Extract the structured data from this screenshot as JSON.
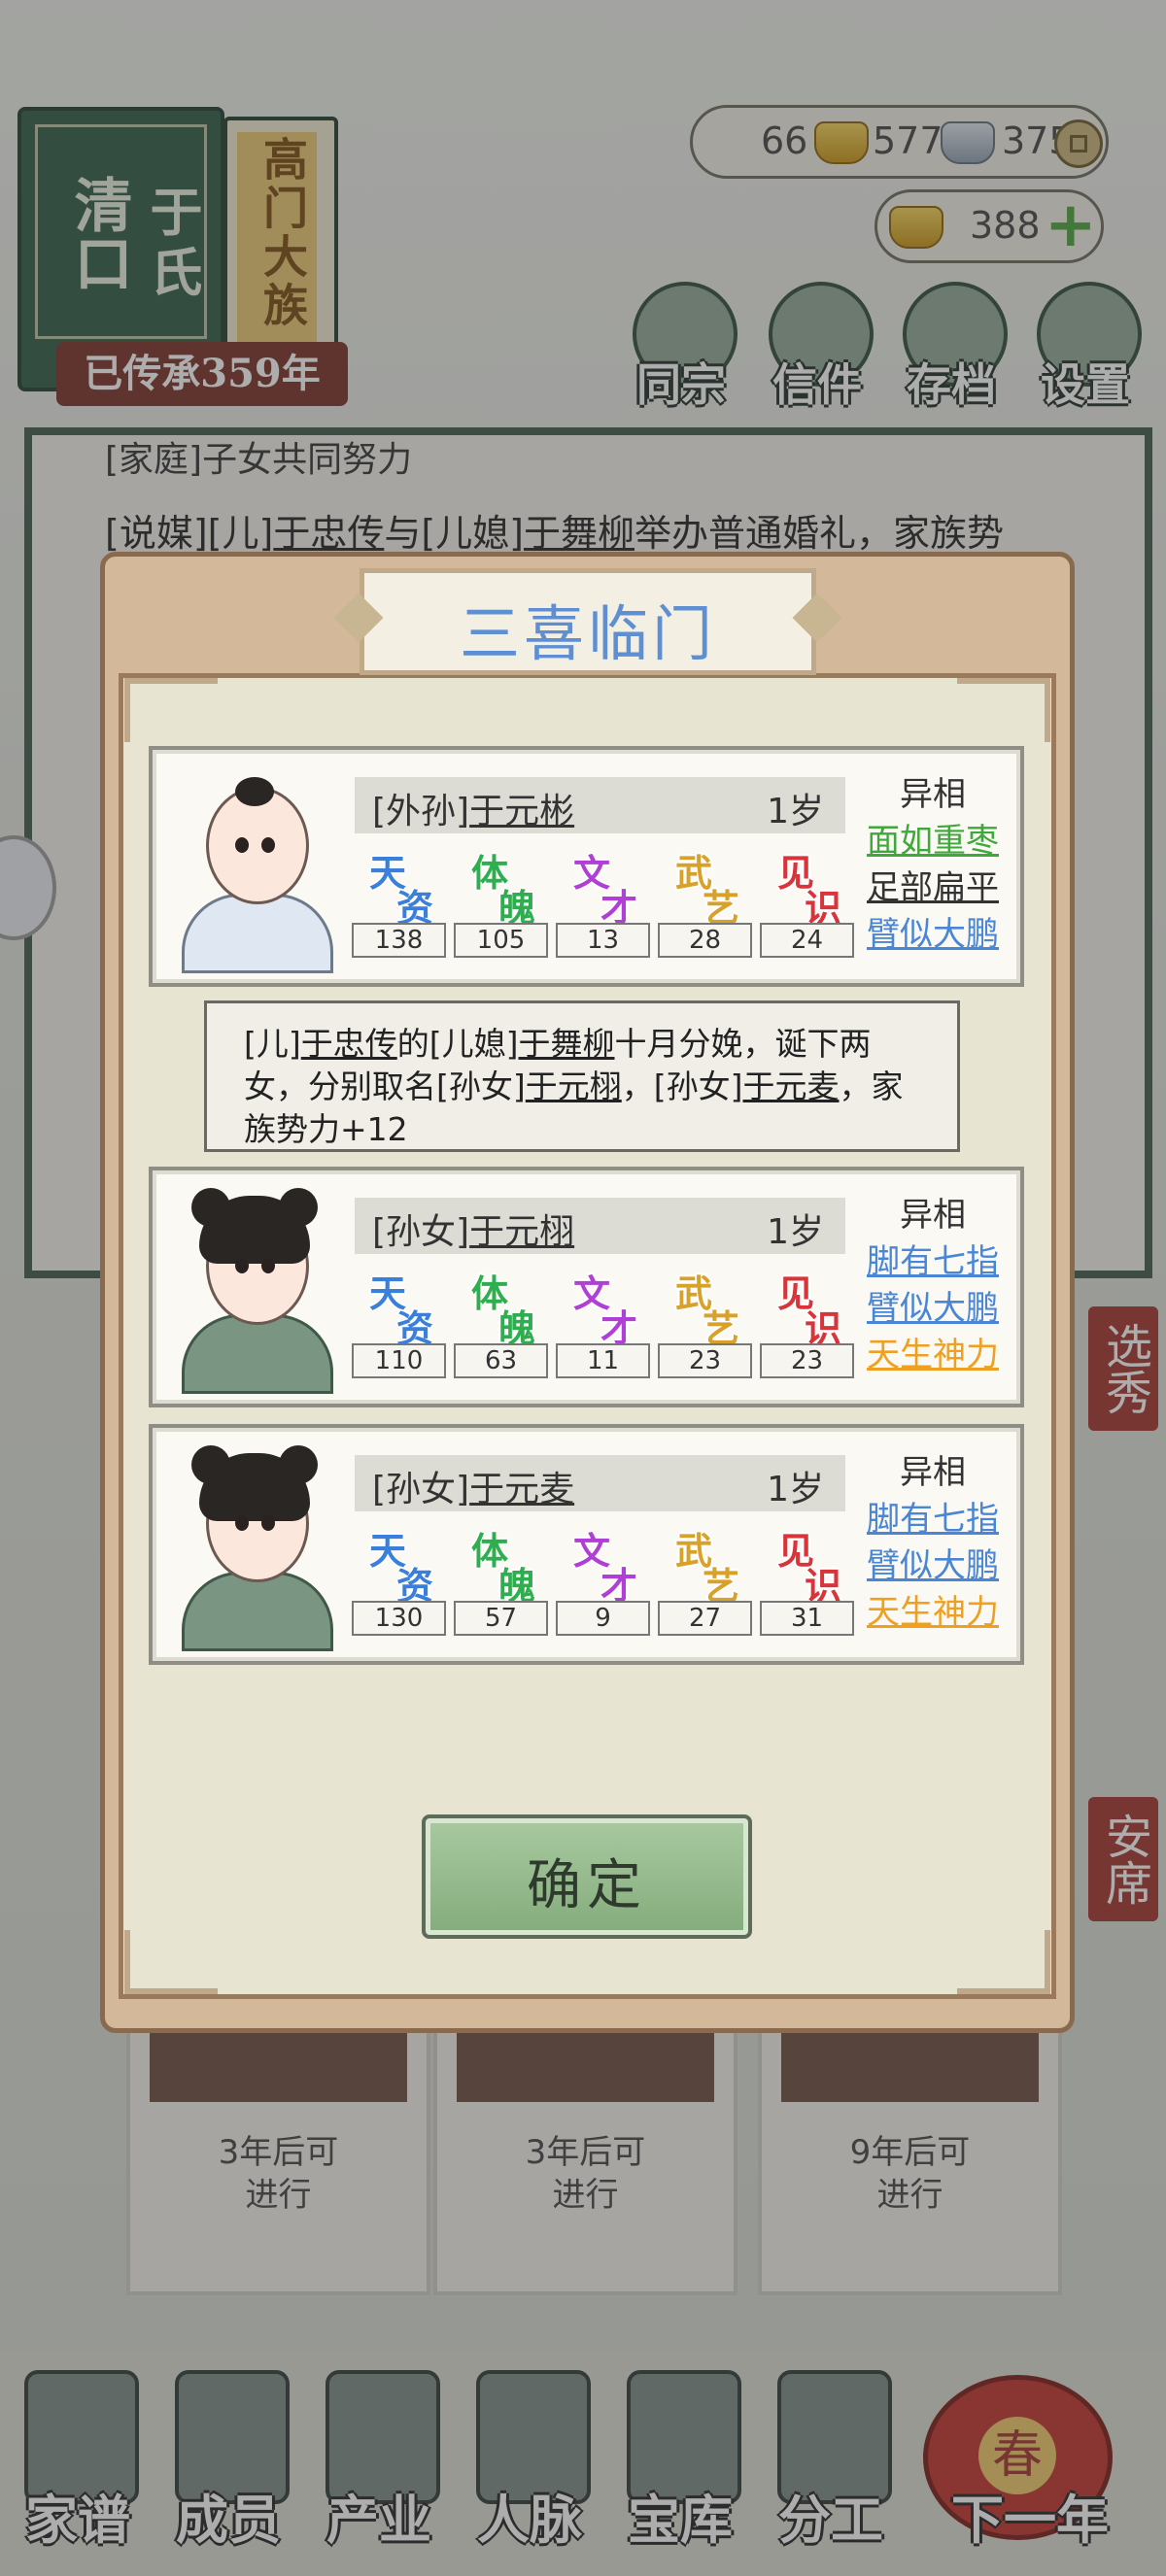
{
  "clan": {
    "name": "于氏",
    "region": "清口",
    "rank": "高门大族",
    "heritage": "已传承359年"
  },
  "resources": {
    "gold_ingot": "66",
    "silver_ingot": "577",
    "coin": "375",
    "premium_gold": "388"
  },
  "top_menu": [
    {
      "label": "同宗",
      "icon": "clan-book-icon"
    },
    {
      "label": "信件",
      "icon": "letter-icon"
    },
    {
      "label": "存档",
      "icon": "save-icon"
    },
    {
      "label": "设置",
      "icon": "gear-icon"
    }
  ],
  "log": {
    "line1": "[家庭]子女共同努力",
    "line2_prefix": "[说媒][儿]",
    "line2_name1": "于忠传",
    "line2_mid": "与[儿媳]",
    "line2_name2": "于舞柳",
    "line2_suffix": "举办普通婚礼，家族势"
  },
  "side_tags": [
    "选秀",
    "安席"
  ],
  "background_cards": [
    {
      "text1": "3年后可",
      "text2": "进行"
    },
    {
      "text1": "3年后可",
      "text2": "进行"
    },
    {
      "text1": "9年后可",
      "text2": "进行"
    }
  ],
  "bottom_nav": [
    {
      "label": "家谱",
      "icon": "genealogy-icon"
    },
    {
      "label": "成员",
      "icon": "member-icon"
    },
    {
      "label": "产业",
      "icon": "property-icon"
    },
    {
      "label": "人脉",
      "icon": "network-icon"
    },
    {
      "label": "宝库",
      "icon": "treasury-icon"
    },
    {
      "label": "分工",
      "icon": "scroll-icon"
    },
    {
      "label": "下一年",
      "icon": "lantern-icon",
      "badge": "春"
    }
  ],
  "modal": {
    "title": "三喜临门",
    "trait_header": "异相",
    "attribute_labels": [
      {
        "c1": "天",
        "c2": "资",
        "color": "#3a7fd9"
      },
      {
        "c1": "体",
        "c2": "魄",
        "color": "#2fae4f"
      },
      {
        "c1": "文",
        "c2": "才",
        "color": "#b03fd6"
      },
      {
        "c1": "武",
        "c2": "艺",
        "color": "#d8a12a"
      },
      {
        "c1": "见",
        "c2": "识",
        "color": "#d9343a"
      }
    ],
    "persons": [
      {
        "relation": "[外孙]",
        "name": "于元彬",
        "age": "1岁",
        "stats": [
          "138",
          "105",
          "13",
          "28",
          "24"
        ],
        "traits": [
          {
            "text": "面如重枣",
            "color": "#3fa83a"
          },
          {
            "text": "足部扁平",
            "color": "#333333"
          },
          {
            "text": "臂似大鹏",
            "color": "#4a86d6"
          }
        ]
      },
      {
        "relation": "[孙女]",
        "name": "于元栩",
        "age": "1岁",
        "stats": [
          "110",
          "63",
          "11",
          "23",
          "23"
        ],
        "traits": [
          {
            "text": "脚有七指",
            "color": "#4a86d6"
          },
          {
            "text": "臂似大鹏",
            "color": "#4a86d6"
          },
          {
            "text": "天生神力",
            "color": "#f0a020"
          }
        ]
      },
      {
        "relation": "[孙女]",
        "name": "于元麦",
        "age": "1岁",
        "stats": [
          "130",
          "57",
          "9",
          "27",
          "31"
        ],
        "traits": [
          {
            "text": "脚有七指",
            "color": "#4a86d6"
          },
          {
            "text": "臂似大鹏",
            "color": "#4a86d6"
          },
          {
            "text": "天生神力",
            "color": "#f0a020"
          }
        ]
      }
    ],
    "message": {
      "p1": "[儿]",
      "n1": "于忠传",
      "p2": "的[儿媳]",
      "n2": "于舞柳",
      "p3": "十月分娩，诞下两女，分别取名[孙女]",
      "n3": "于元栩",
      "p4": "，[孙女]",
      "n4": "于元麦",
      "p5": "，家族势力+12"
    },
    "confirm_label": "确定"
  }
}
